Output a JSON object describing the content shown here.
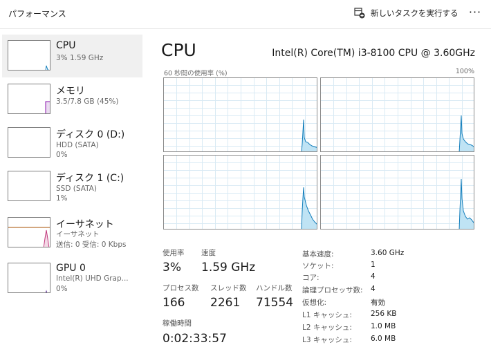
{
  "header": {
    "title": "パフォーマンス",
    "run_task_label": "新しいタスクを実行する",
    "more_label": "···"
  },
  "sidebar": {
    "items": [
      {
        "name": "CPU",
        "line1": "3%  1.59 GHz",
        "line2": "",
        "line3": ""
      },
      {
        "name": "メモリ",
        "line1": "3.5/7.8 GB (45%)",
        "line2": "",
        "line3": ""
      },
      {
        "name": "ディスク 0 (D:)",
        "line1": "HDD (SATA)",
        "line2": "0%",
        "line3": ""
      },
      {
        "name": "ディスク 1 (C:)",
        "line1": "SSD (SATA)",
        "line2": "1%",
        "line3": ""
      },
      {
        "name": "イーサネット",
        "line1": "イーサネット",
        "line2": "送信: 0 受信: 0 Kbps",
        "line3": ""
      },
      {
        "name": "GPU 0",
        "line1": "Intel(R) UHD Grap...",
        "line2": "0%",
        "line3": ""
      }
    ]
  },
  "main": {
    "title": "CPU",
    "model": "Intel(R) Core(TM) i3-8100 CPU @ 3.60GHz",
    "graph_label": "60 秒間の使用率 (%)",
    "graph_max": "100%",
    "stats": {
      "utilization_label": "使用率",
      "utilization_value": "3%",
      "speed_label": "速度",
      "speed_value": "1.59 GHz",
      "processes_label": "プロセス数",
      "processes_value": "166",
      "threads_label": "スレッド数",
      "threads_value": "2261",
      "handles_label": "ハンドル数",
      "handles_value": "71554",
      "uptime_label": "稼働時間",
      "uptime_value": "0:02:33:57"
    },
    "specs": [
      {
        "label": "基本速度:",
        "value": "3.60 GHz"
      },
      {
        "label": "ソケット:",
        "value": "1"
      },
      {
        "label": "コア:",
        "value": "4"
      },
      {
        "label": "論理プロセッサ数:",
        "value": "4"
      },
      {
        "label": "仮想化:",
        "value": "有効"
      },
      {
        "label": "L1 キャッシュ:",
        "value": "256 KB"
      },
      {
        "label": "L2 キャッシュ:",
        "value": "1.0 MB"
      },
      {
        "label": "L3 キャッシュ:",
        "value": "6.0 MB"
      }
    ]
  },
  "colors": {
    "cpu_line": "#117dbb",
    "cpu_fill": "#bfe3f4",
    "memory_line": "#8b12ae",
    "ethernet_line": "#a74f01",
    "grid": "#d9eaf4"
  },
  "icons": {
    "run_task": "run-task-icon",
    "more": "more-options-icon"
  }
}
